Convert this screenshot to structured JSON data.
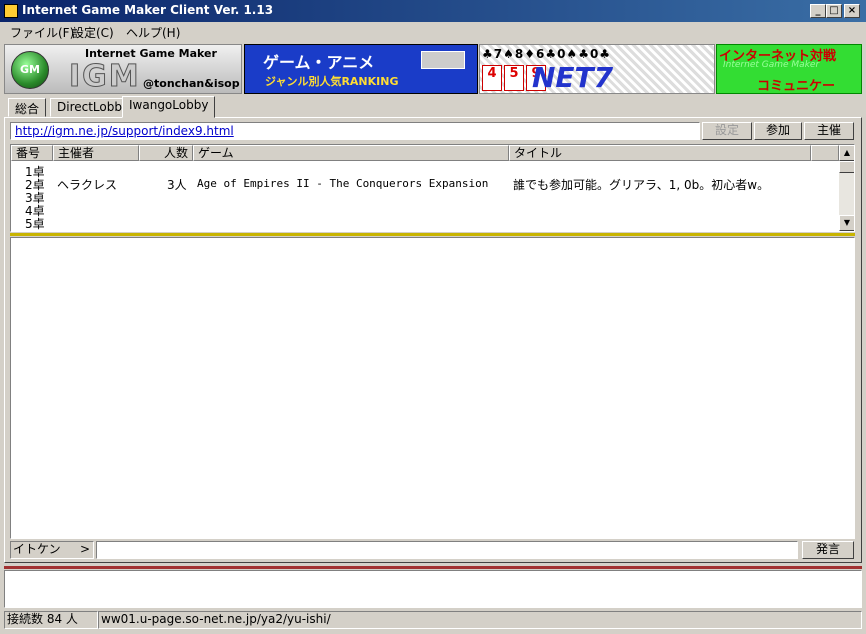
{
  "window": {
    "title": "Internet Game Maker Client Ver. 1.13",
    "minimize_glyph": "_",
    "maximize_glyph": "□",
    "close_glyph": "×"
  },
  "menu": {
    "items": [
      {
        "label": "ファイル(F)"
      },
      {
        "label": "設定(C)"
      },
      {
        "label": "ヘルプ(H)"
      }
    ]
  },
  "banners": {
    "igm": {
      "subtitle": "Internet Game Maker",
      "logo_text": "IGM",
      "credit": "@tonchan&isop",
      "emblem": "GM"
    },
    "ranking": {
      "line1": "ゲーム・アニメ",
      "line2": "ジャンル別人気RANKING"
    },
    "net7": {
      "cards_top": "♣7♠8♦6♣0♠♣0♣",
      "logo": "NET7",
      "card_a": "4",
      "card_b": "5",
      "card_c": "9"
    },
    "community": {
      "line1": "インターネット対戦",
      "line2": "コミュニケー",
      "line3": "Internet Game Maker"
    }
  },
  "tabs": [
    {
      "label": "総合"
    },
    {
      "label": "DirectLobby"
    },
    {
      "label": "IwangoLobby"
    }
  ],
  "toolbar": {
    "url": "http://igm.ne.jp/support/index9.html",
    "settings_label": "設定",
    "join_label": "参加",
    "host_label": "主催"
  },
  "table": {
    "columns": [
      "番号",
      "主催者",
      "人数",
      "ゲーム",
      "タイトル"
    ],
    "rows": [
      {
        "num": "1卓",
        "host": "",
        "players": "",
        "game": "",
        "title": ""
      },
      {
        "num": "2卓",
        "host": "ヘラクレス",
        "players": "3人",
        "game": "Age of Empires II - The Conquerors Expansion",
        "title": "誰でも参加可能。グリアラ、1, 0b。初心者w。"
      },
      {
        "num": "3卓",
        "host": "",
        "players": "",
        "game": "",
        "title": ""
      },
      {
        "num": "4卓",
        "host": "",
        "players": "",
        "game": "",
        "title": ""
      },
      {
        "num": "5卓",
        "host": "",
        "players": "",
        "game": "",
        "title": ""
      }
    ],
    "scroll_up": "▲",
    "scroll_down": "▼"
  },
  "input": {
    "nickname": "イトケン",
    "prompt": ">",
    "message_value": "",
    "send_label": "発言"
  },
  "status": {
    "connections": "接続数 84 人",
    "url": "ww01.u-page.so-net.ne.jp/ya2/yu-ishi/"
  }
}
